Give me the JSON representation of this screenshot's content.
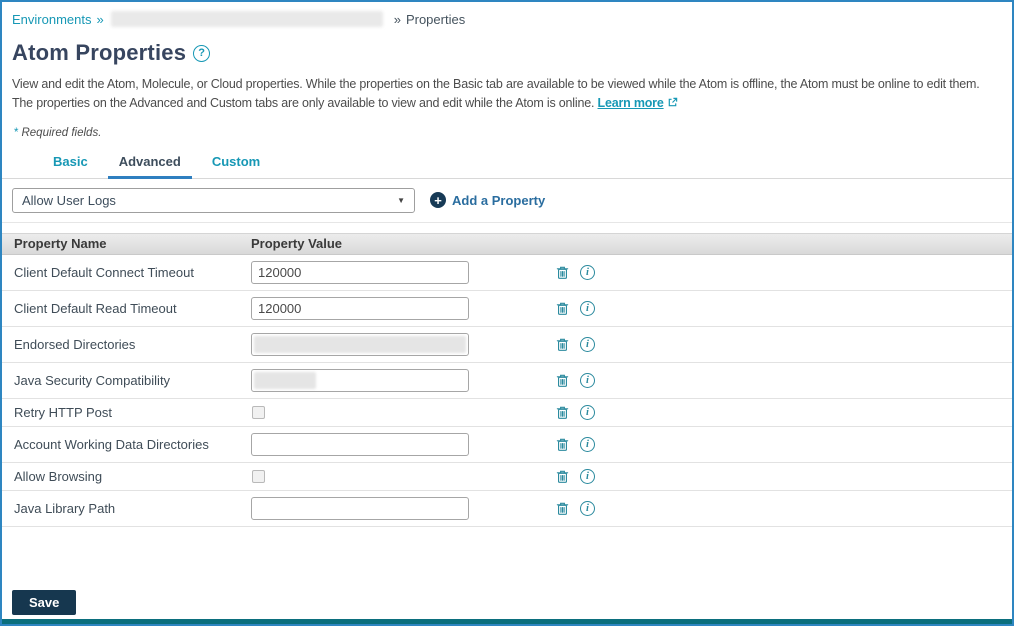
{
  "breadcrumb": {
    "environments": "Environments",
    "separator": "»",
    "current": "Properties",
    "redacted_segment": true
  },
  "header": {
    "title": "Atom Properties",
    "help_icon": "?"
  },
  "description": {
    "text": "View and edit the Atom, Molecule, or Cloud properties. While the properties on the Basic tab are available to be viewed while the Atom is offline, the Atom must be online to edit them. The properties on the Advanced and Custom tabs are only available to view and edit while the Atom is online.",
    "learn_more_label": "Learn more"
  },
  "required_note": {
    "asterisk": "*",
    "text": "Required fields."
  },
  "tabs": [
    {
      "label": "Basic",
      "active": false
    },
    {
      "label": "Advanced",
      "active": true
    },
    {
      "label": "Custom",
      "active": false
    }
  ],
  "property_selector": {
    "selected": "Allow User Logs"
  },
  "add_property": {
    "label": "Add a Property"
  },
  "table": {
    "columns": [
      "Property Name",
      "Property Value"
    ],
    "rows": [
      {
        "name": "Client Default Connect Timeout",
        "type": "text",
        "value": "120000",
        "redacted": "none"
      },
      {
        "name": "Client Default Read Timeout",
        "type": "text",
        "value": "120000",
        "redacted": "none"
      },
      {
        "name": "Endorsed Directories",
        "type": "text",
        "value": "",
        "redacted": "full"
      },
      {
        "name": "Java Security Compatibility",
        "type": "text",
        "value": "",
        "redacted": "partial"
      },
      {
        "name": "Retry HTTP Post",
        "type": "checkbox",
        "checked": false
      },
      {
        "name": "Account Working Data Directories",
        "type": "text",
        "value": "",
        "redacted": "none"
      },
      {
        "name": "Allow Browsing",
        "type": "checkbox",
        "checked": false
      },
      {
        "name": "Java Library Path",
        "type": "text",
        "value": "",
        "redacted": "none"
      }
    ]
  },
  "actions": {
    "save_label": "Save"
  },
  "icons": {
    "help": "?",
    "add": "+",
    "info": "i",
    "dropdown_arrow": "▼",
    "delete": "trash",
    "external_link": "open-in-new"
  },
  "colors": {
    "link_teal": "#1798b5",
    "icon_teal": "#2b8a9e",
    "tab_underline_blue": "#2e7fc0",
    "add_plus_navy": "#173a56",
    "save_navy": "#16374f",
    "outer_border_blue": "#2e86c1",
    "bottom_bar_teal": "#0b6f7d",
    "header_gray": "#dfdfdf"
  }
}
